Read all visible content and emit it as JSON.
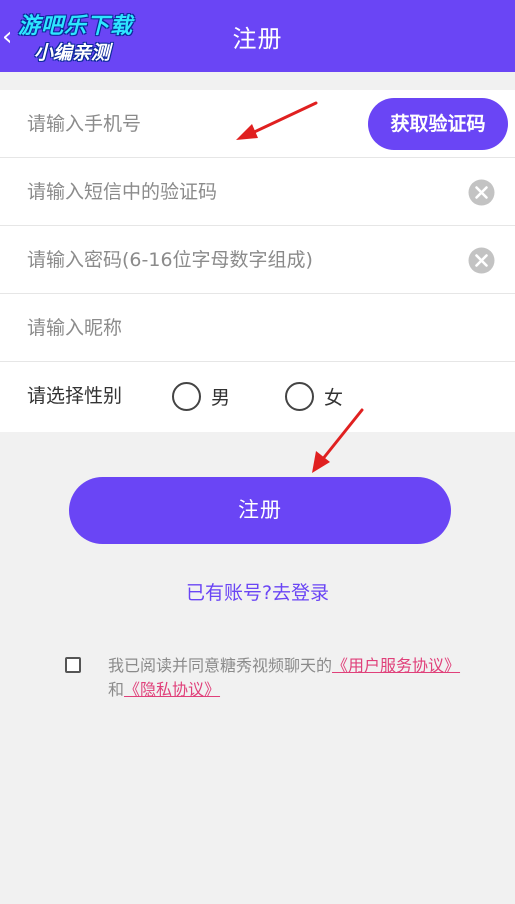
{
  "header": {
    "title": "注册",
    "back_symbol": "‹",
    "watermark_line1": "游吧乐下载",
    "watermark_line2": "小编亲测"
  },
  "form": {
    "phone_placeholder": "请输入手机号",
    "get_code_label": "获取验证码",
    "sms_code_placeholder": "请输入短信中的验证码",
    "password_placeholder": "请输入密码(6-16位字母数字组成)",
    "nickname_placeholder": "请输入昵称",
    "gender_label": "请选择性别",
    "gender_options": [
      "男",
      "女"
    ]
  },
  "register_label": "注册",
  "login_link": "已有账号?去登录",
  "agreement": {
    "prefix": "我已阅读并同意糖秀视频聊天的",
    "user_agreement": "《用户服务协议》",
    "and": "和",
    "privacy_agreement": "《隐私协议》"
  },
  "colors": {
    "primary": "#6a45f5",
    "link": "#e0407a",
    "background": "#f1f1f1",
    "annotation_arrow": "#e02020"
  },
  "icons": {
    "clear": "clear-circle-icon",
    "back": "chevron-left-icon",
    "arrow": "red-arrow-annotation"
  }
}
